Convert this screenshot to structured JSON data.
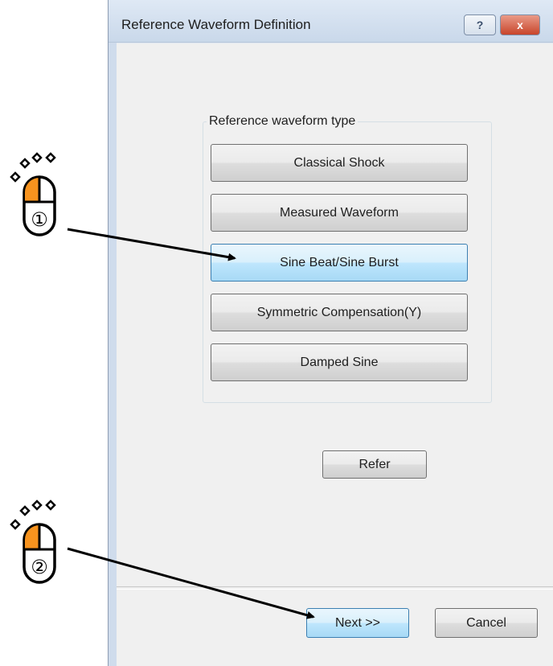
{
  "window": {
    "title": "Reference Waveform Definition",
    "help_label": "?",
    "close_label": "x"
  },
  "group": {
    "legend": "Reference waveform type",
    "buttons": [
      "Classical Shock",
      "Measured Waveform",
      "Sine Beat/Sine Burst",
      "Symmetric Compensation(Y)",
      "Damped Sine"
    ],
    "active_index": 2
  },
  "refer_label": "Refer",
  "footer": {
    "next_label": "Next >>",
    "cancel_label": "Cancel"
  },
  "annotations": {
    "step1": "①",
    "step2": "②",
    "mouse_accent": "#f7931e"
  }
}
